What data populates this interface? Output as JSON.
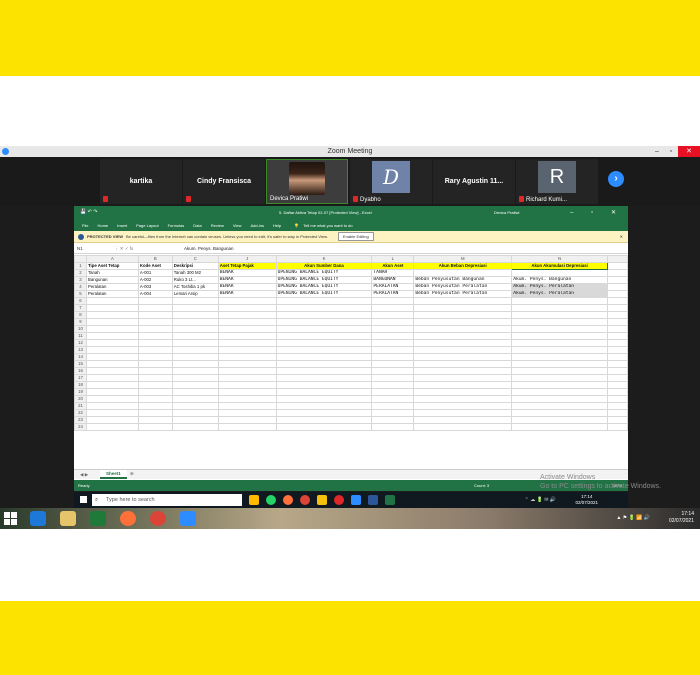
{
  "zoom": {
    "title": "Zoom Meeting",
    "participants": [
      {
        "name": "kartika"
      },
      {
        "name": "Cindy Fransisca"
      },
      {
        "name": "Devica Pratiwi"
      },
      {
        "name": "Dyabho"
      },
      {
        "name": "Rary Agustin 11..."
      },
      {
        "name": "Richard Kumi...",
        "initial": "R"
      }
    ],
    "next_icon": "arrow-right-icon"
  },
  "excel": {
    "title": "5. Daftar Aktiva Tetap 02-07  [Protected View]  -  Excel",
    "user": "Devica Pratiwi",
    "ribbon_tabs": [
      "File",
      "Home",
      "Insert",
      "Page Layout",
      "Formulas",
      "Data",
      "Review",
      "View",
      "Add-ins",
      "Help"
    ],
    "tell_me": "Tell me what you want to do",
    "protected_label": "PROTECTED VIEW",
    "protected_msg": "Be careful—files from the Internet can contain viruses. Unless you need to edit, it's safer to stay in Protected View.",
    "enable_editing": "Enable Editing",
    "name_box": "N1",
    "formula_value": "Akum. Penys. Bangunan",
    "columns": [
      "A",
      "B",
      "C",
      "J",
      "K",
      "L",
      "M",
      "N"
    ],
    "headers": [
      "Tipe Aset Tetap",
      "Kode Aset",
      "Deskripsi",
      "Aset Tetap Pajak",
      "Akun Sumber Dana",
      "Akun Aset",
      "Akun Beban Depresiasi",
      "Akun Akumulasi Depresiasi"
    ],
    "rows": [
      [
        "Tanah",
        "A-001",
        "Tanah 300 M2",
        "BENAR",
        "OPENING BALANCE EQUITY",
        "TANAH",
        "",
        ""
      ],
      [
        "Bangunan",
        "A-002",
        "Ruko 3 Lt...",
        "BENAR",
        "OPENING BALANCE EQUITY",
        "BANGUNAN",
        "Beban Penyusutan Bangunan",
        "Akum. Penys. Bangunan"
      ],
      [
        "Peralatan",
        "A-003",
        "AC Toshiba 1 pk",
        "BENAR",
        "OPENING BALANCE EQUITY",
        "PERALATAN",
        "Beban Penyusutan Peralatan",
        "Akum. Penys. Peralatan"
      ],
      [
        "Peralatan",
        "A-004",
        "Lemari Arsip",
        "BENAR",
        "OPENING BALANCE EQUITY",
        "PERALATAN",
        "Beban Penyusutan Peralatan",
        "Akum. Penys. Peralatan"
      ]
    ],
    "row_numbers": [
      "1",
      "2",
      "3",
      "4",
      "5",
      "6",
      "7",
      "8",
      "9",
      "10",
      "11",
      "12",
      "13",
      "14",
      "15",
      "16",
      "17",
      "18",
      "19",
      "20",
      "21",
      "22",
      "23",
      "24"
    ],
    "sheet_tab": "Sheet1",
    "status_ready": "Ready",
    "status_count": "Count: 3",
    "zoom_level": "100%"
  },
  "activate": {
    "line1": "Activate Windows",
    "line2": "Go to PC settings to activate Windows."
  },
  "inner_taskbar": {
    "search_placeholder": "Type here to search",
    "time": "17:14",
    "date": "02/07/2021"
  },
  "outer_taskbar": {
    "time": "17:14",
    "date": "02/07/2021"
  }
}
